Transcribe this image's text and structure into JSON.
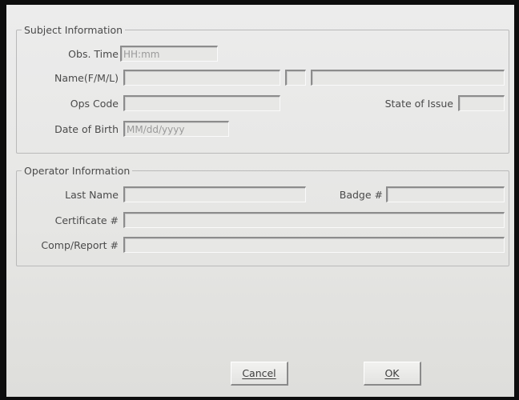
{
  "subject": {
    "legend": "Subject Information",
    "obs_time": {
      "label": "Obs. Time",
      "placeholder": "HH:mm",
      "value": ""
    },
    "name": {
      "label": "Name(F/M/L)",
      "first": "",
      "middle": "",
      "last": ""
    },
    "ops_code": {
      "label": "Ops Code",
      "value": ""
    },
    "state_of_issue": {
      "label": "State of Issue",
      "value": ""
    },
    "dob": {
      "label": "Date of Birth",
      "placeholder": "MM/dd/yyyy",
      "value": ""
    }
  },
  "operator": {
    "legend": "Operator Information",
    "last_name": {
      "label": "Last Name",
      "value": ""
    },
    "badge": {
      "label": "Badge #",
      "value": ""
    },
    "certificate": {
      "label": "Certificate #",
      "value": ""
    },
    "comp_report": {
      "label": "Comp/Report #",
      "value": ""
    }
  },
  "buttons": {
    "cancel": "Cancel",
    "ok": "OK"
  }
}
